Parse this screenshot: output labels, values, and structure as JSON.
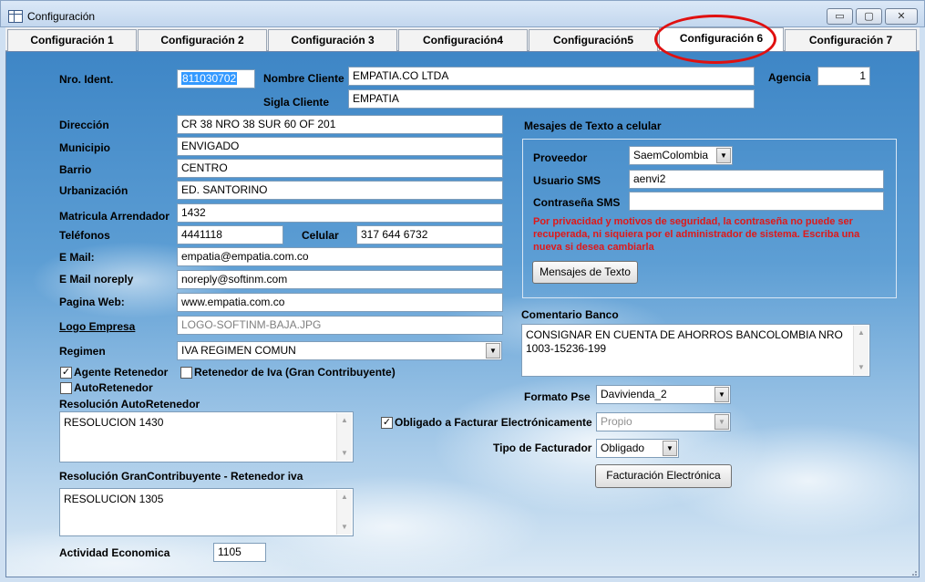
{
  "window": {
    "title": "Configuración",
    "controls": {
      "minimize": "▭",
      "maximize": "▢",
      "close": "✕"
    }
  },
  "tabs": [
    {
      "label": "Configuración 1",
      "active": false
    },
    {
      "label": "Configuración 2",
      "active": false
    },
    {
      "label": "Configuración 3",
      "active": false
    },
    {
      "label": "Configuración4",
      "active": false
    },
    {
      "label": "Configuración5",
      "active": false
    },
    {
      "label": "Configuración 6",
      "active": true
    },
    {
      "label": "Configuración 7",
      "active": false
    }
  ],
  "client": {
    "nro_ident": {
      "label": "Nro. Ident.",
      "value": "811030702"
    },
    "nombre_cliente": {
      "label": "Nombre Cliente",
      "value": "EMPATIA.CO LTDA"
    },
    "agencia": {
      "label": "Agencia",
      "value": "1"
    },
    "sigla_cliente": {
      "label": "Sigla Cliente",
      "value": "EMPATIA"
    }
  },
  "form": {
    "direccion": {
      "label": "Dirección",
      "value": "CR 38 NRO 38 SUR 60 OF 201"
    },
    "municipio": {
      "label": "Municipio",
      "value": "ENVIGADO"
    },
    "barrio": {
      "label": "Barrio",
      "value": "CENTRO"
    },
    "urbanizacion": {
      "label": "Urbanización",
      "value": "ED. SANTORINO"
    },
    "matricula": {
      "label": "Matricula Arrendador",
      "value": "1432"
    },
    "telefonos": {
      "label": "Teléfonos",
      "value": "4441118"
    },
    "celular": {
      "label": "Celular",
      "value": "317 644 6732"
    },
    "email": {
      "label": "E Mail:",
      "value": "empatia@empatia.com.co"
    },
    "email_noreply": {
      "label": "E Mail noreply",
      "value": "noreply@softinm.com"
    },
    "pagina_web": {
      "label": "Pagina Web:",
      "value": "www.empatia.com.co"
    },
    "logo_empresa": {
      "label": "Logo Empresa",
      "value": "LOGO-SOFTINM-BAJA.JPG"
    },
    "regimen": {
      "label": "Regimen",
      "value": "IVA REGIMEN COMUN"
    },
    "agente_retenedor": {
      "label": "Agente Retenedor",
      "checked": true
    },
    "retenedor_iva": {
      "label": "Retenedor de Iva (Gran Contribuyente)",
      "checked": false
    },
    "autoretenedor": {
      "label": "AutoRetenedor",
      "checked": false
    },
    "resolucion_auto": {
      "label": "Resolución AutoRetenedor",
      "value": "RESOLUCION 1430"
    },
    "resolucion_gran": {
      "label": "Resolución GranContribuyente  - Retenedor iva",
      "value": "RESOLUCION  1305"
    },
    "actividad": {
      "label": "Actividad Economica",
      "value": "1105"
    }
  },
  "sms": {
    "title": "Mesajes de Texto a celular",
    "proveedor": {
      "label": "Proveedor",
      "value": "SaemColombia"
    },
    "usuario": {
      "label": "Usuario SMS",
      "value": "aenvi2"
    },
    "contrasena": {
      "label": "Contraseña SMS",
      "value": ""
    },
    "warning": "Por privacidad y motivos de seguridad, la contraseña no puede ser recuperada, ni siquiera por el administrador de sistema. Escriba una nueva si desea cambiarla",
    "button": "Mensajes de Texto"
  },
  "banco": {
    "label": "Comentario Banco",
    "value": "CONSIGNAR EN CUENTA DE AHORROS BANCOLOMBIA NRO 1003-15236-199"
  },
  "facturacion": {
    "formato_pse": {
      "label": "Formato Pse",
      "value": "Davivienda_2"
    },
    "obligado": {
      "label": "Obligado a Facturar Electrónicamente",
      "checked": true,
      "value": "Propio"
    },
    "tipo": {
      "label": "Tipo de Facturador",
      "value": "Obligado"
    },
    "button": "Facturación Electrónica"
  },
  "colors": {
    "accent": "#3e86c6",
    "warning": "#e01818",
    "highlight_ring": "#e01010"
  },
  "icons": {
    "checkmark": "✓",
    "dropdown": "▼",
    "scroll_up": "▲",
    "scroll_down": "▼"
  }
}
